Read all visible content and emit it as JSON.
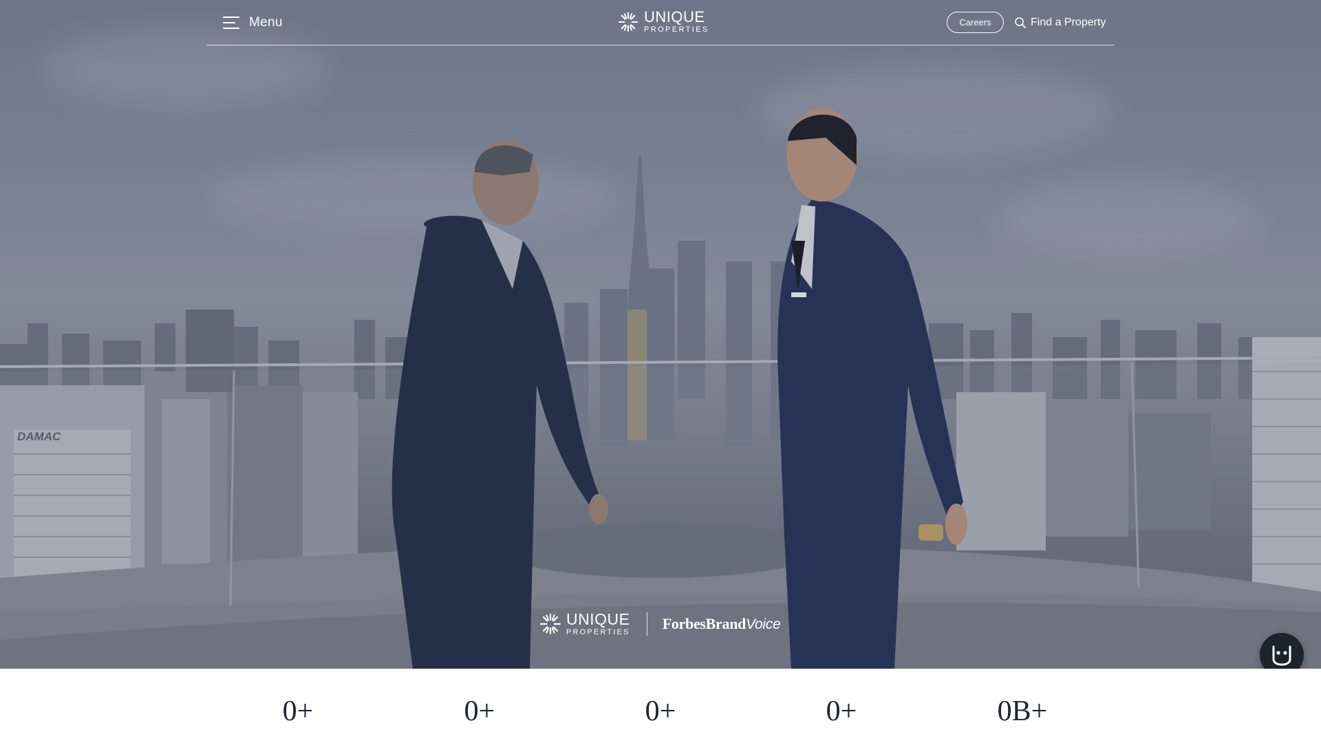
{
  "header": {
    "menu_label": "Menu",
    "logo_main": "UNIQUE",
    "logo_sub": "PROPERTIES",
    "careers_label": "Careers",
    "find_label": "Find a Property"
  },
  "hero": {
    "billboard_text": "DAMAC",
    "brand_logo_main": "UNIQUE",
    "brand_logo_sub": "PROPERTIES",
    "forbes_main": "ForbesBrand",
    "forbes_voice": "Voice"
  },
  "stats": [
    {
      "value": "0+"
    },
    {
      "value": "0+"
    },
    {
      "value": "0+"
    },
    {
      "value": "0+"
    },
    {
      "value": "0B+"
    }
  ],
  "icons": {
    "menu": "hamburger-icon",
    "logo": "sunburst-logo-icon",
    "search": "search-icon",
    "chat": "chatbot-face-icon",
    "whatsapp": "whatsapp-icon"
  },
  "colors": {
    "whatsapp": "#2aa744",
    "chat_bg": "#1b242a",
    "stat_text": "#1d2430"
  }
}
